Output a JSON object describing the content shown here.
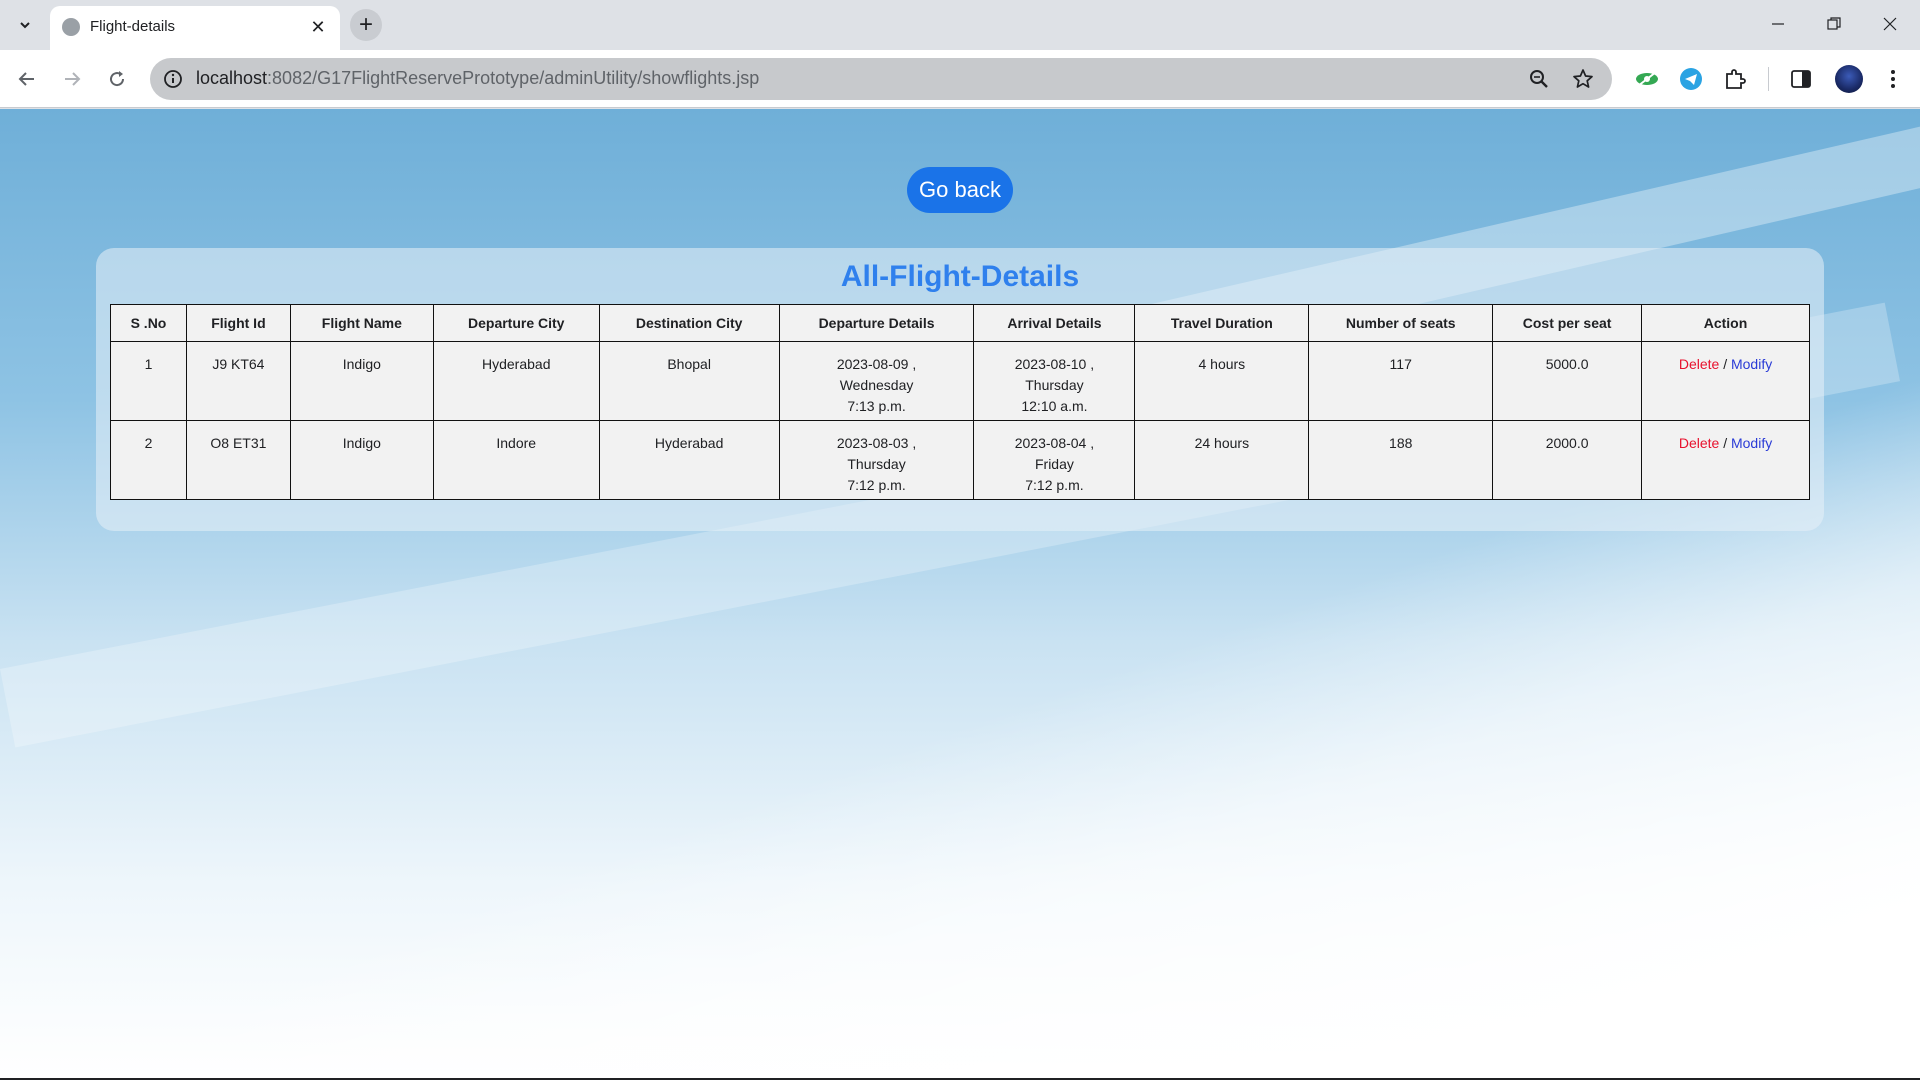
{
  "browser": {
    "tab_title": "Flight-details",
    "url_host": "localhost",
    "url_rest": ":8082/G17FlightReservePrototype/adminUtility/showflights.jsp"
  },
  "page": {
    "go_back_label": "Go back",
    "title": "All-Flight-Details"
  },
  "table": {
    "headers": [
      "S .No",
      "Flight Id",
      "Flight Name",
      "Departure City",
      "Destination City",
      "Departure Details",
      "Arrival Details",
      "Travel Duration",
      "Number of seats",
      "Cost per seat",
      "Action"
    ],
    "rows": [
      {
        "sno": "1",
        "flight_id": "J9 KT64",
        "flight_name": "Indigo",
        "departure_city": "Hyderabad",
        "destination_city": "Bhopal",
        "departure": {
          "date": "2023-08-09 ,",
          "day": "Wednesday",
          "time": "7:13 p.m."
        },
        "arrival": {
          "date": "2023-08-10 ,",
          "day": "Thursday",
          "time": "12:10 a.m."
        },
        "duration": "4 hours",
        "seats": "117",
        "cost": "5000.0",
        "delete_label": "Delete",
        "separator": "/",
        "modify_label": "Modify"
      },
      {
        "sno": "2",
        "flight_id": "O8 ET31",
        "flight_name": "Indigo",
        "departure_city": "Indore",
        "destination_city": "Hyderabad",
        "departure": {
          "date": "2023-08-03 ,",
          "day": "Thursday",
          "time": "7:12 p.m."
        },
        "arrival": {
          "date": "2023-08-04 ,",
          "day": "Friday",
          "time": "7:12 p.m."
        },
        "duration": "24 hours",
        "seats": "188",
        "cost": "2000.0",
        "delete_label": "Delete",
        "separator": "/",
        "modify_label": "Modify"
      }
    ]
  },
  "colors": {
    "accent": "#1a73e8",
    "title": "#2f80ed",
    "delete": "#e8112d",
    "modify": "#2a3bd6"
  },
  "icons": [
    "tab-search-icon",
    "globe-icon",
    "close-icon",
    "plus-icon",
    "minimize-icon",
    "restore-icon",
    "back-arrow-icon",
    "forward-arrow-icon",
    "reload-icon",
    "site-info-icon",
    "zoom-icon",
    "star-icon",
    "extension-icon",
    "puzzle-icon",
    "side-panel-icon",
    "profile-avatar",
    "kebab-menu-icon"
  ]
}
